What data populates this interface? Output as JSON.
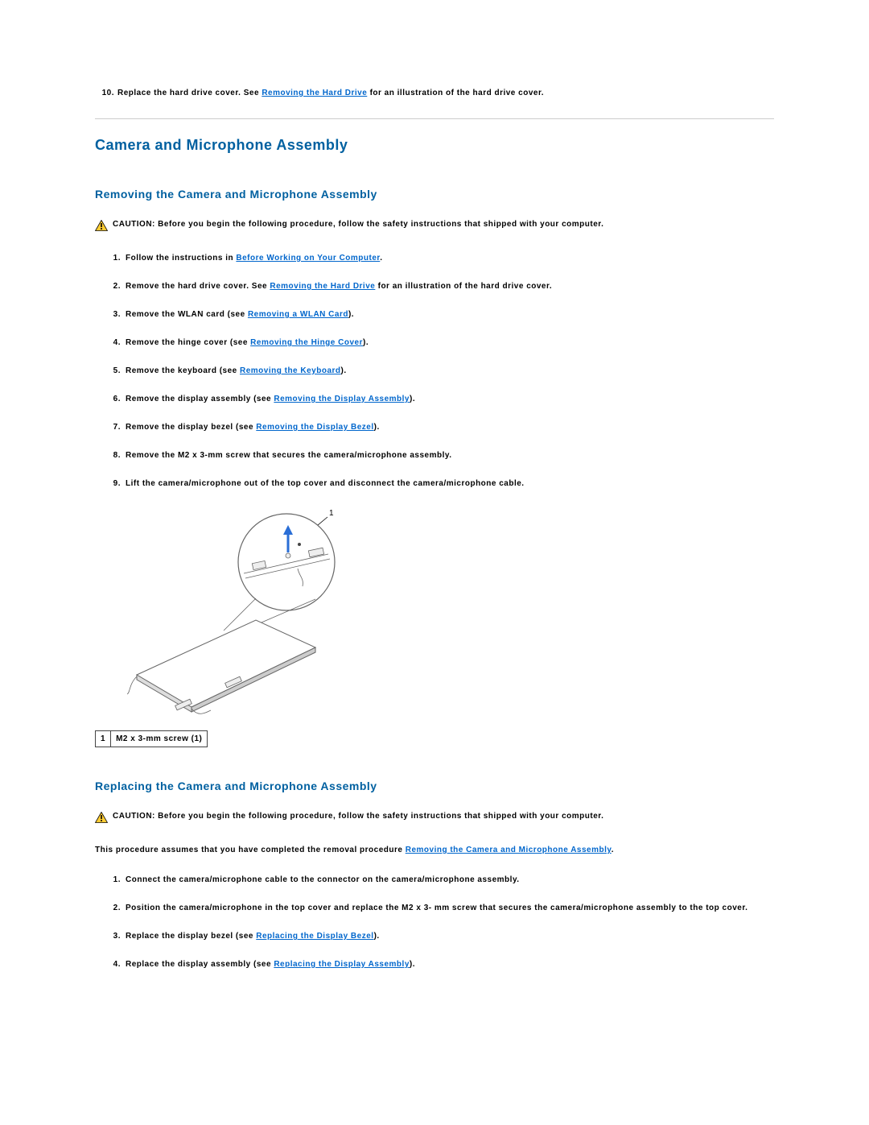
{
  "top_step": {
    "num": "10.",
    "pre": "Replace the hard drive cover. See ",
    "link": "Removing the Hard Drive",
    "post": " for an illustration of the hard drive cover."
  },
  "section_title": "Camera and Microphone Assembly",
  "removing": {
    "title": "Removing the Camera and Microphone Assembly",
    "caution_label": "CAUTION:",
    "caution_text": " Before you begin the following procedure, follow the safety instructions that shipped with your computer.",
    "steps": [
      {
        "num": "1.",
        "pre": "Follow the instructions in ",
        "link": "Before Working on Your Computer",
        "post": "."
      },
      {
        "num": "2.",
        "pre": "Remove the hard drive cover. See ",
        "link": "Removing the Hard Drive",
        "post": " for an illustration of the hard drive cover."
      },
      {
        "num": "3.",
        "pre": "Remove the WLAN card (see ",
        "link": "Removing a WLAN Card",
        "post": ")."
      },
      {
        "num": "4.",
        "pre": "Remove the hinge cover (see ",
        "link": "Removing the Hinge Cover",
        "post": ")."
      },
      {
        "num": "5.",
        "pre": "Remove the keyboard (see ",
        "link": "Removing the Keyboard",
        "post": ")."
      },
      {
        "num": "6.",
        "pre": "Remove the display assembly (see ",
        "link": "Removing the Display Assembly",
        "post": ")."
      },
      {
        "num": "7.",
        "pre": "Remove the display bezel (see ",
        "link": "Removing the Display Bezel",
        "post": ")."
      },
      {
        "num": "8.",
        "pre": "Remove the M2 x 3-mm screw that secures the camera/microphone assembly.",
        "link": "",
        "post": ""
      },
      {
        "num": "9.",
        "pre": "Lift the camera/microphone out of the top cover and disconnect the camera/microphone cable.",
        "link": "",
        "post": ""
      }
    ],
    "legend": {
      "num": "1",
      "label": "M2 x 3-mm screw (1)"
    }
  },
  "replacing": {
    "title": "Replacing the Camera and Microphone Assembly",
    "caution_label": "CAUTION:",
    "caution_text": " Before you begin the following procedure, follow the safety instructions that shipped with your computer.",
    "intro_pre": "This procedure assumes that you have completed the removal procedure ",
    "intro_link": "Removing the Camera and Microphone Assembly",
    "intro_post": ".",
    "steps": [
      {
        "num": "1.",
        "pre": "Connect the camera/microphone cable to the connector on the camera/microphone assembly.",
        "link": "",
        "post": ""
      },
      {
        "num": "2.",
        "pre": "Position the camera/microphone in the top cover and replace the M2 x 3- mm screw that secures the camera/microphone assembly to the top cover.",
        "link": "",
        "post": ""
      },
      {
        "num": "3.",
        "pre": "Replace the display bezel (see ",
        "link": "Replacing the Display Bezel",
        "post": ")."
      },
      {
        "num": "4.",
        "pre": "Replace the display assembly (see ",
        "link": "Replacing the Display Assembly",
        "post": ")."
      }
    ]
  }
}
